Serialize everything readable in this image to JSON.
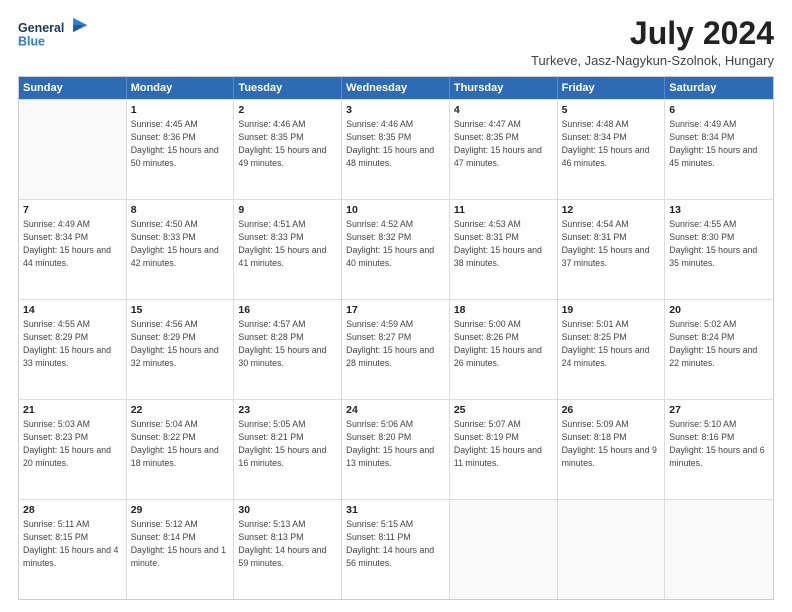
{
  "header": {
    "logo_general": "General",
    "logo_blue": "Blue",
    "month_year": "July 2024",
    "location": "Turkeve, Jasz-Nagykun-Szolnok, Hungary"
  },
  "days_of_week": [
    "Sunday",
    "Monday",
    "Tuesday",
    "Wednesday",
    "Thursday",
    "Friday",
    "Saturday"
  ],
  "weeks": [
    [
      {
        "day": "",
        "sunrise": "",
        "sunset": "",
        "daylight": ""
      },
      {
        "day": "1",
        "sunrise": "Sunrise: 4:45 AM",
        "sunset": "Sunset: 8:36 PM",
        "daylight": "Daylight: 15 hours and 50 minutes."
      },
      {
        "day": "2",
        "sunrise": "Sunrise: 4:46 AM",
        "sunset": "Sunset: 8:35 PM",
        "daylight": "Daylight: 15 hours and 49 minutes."
      },
      {
        "day": "3",
        "sunrise": "Sunrise: 4:46 AM",
        "sunset": "Sunset: 8:35 PM",
        "daylight": "Daylight: 15 hours and 48 minutes."
      },
      {
        "day": "4",
        "sunrise": "Sunrise: 4:47 AM",
        "sunset": "Sunset: 8:35 PM",
        "daylight": "Daylight: 15 hours and 47 minutes."
      },
      {
        "day": "5",
        "sunrise": "Sunrise: 4:48 AM",
        "sunset": "Sunset: 8:34 PM",
        "daylight": "Daylight: 15 hours and 46 minutes."
      },
      {
        "day": "6",
        "sunrise": "Sunrise: 4:49 AM",
        "sunset": "Sunset: 8:34 PM",
        "daylight": "Daylight: 15 hours and 45 minutes."
      }
    ],
    [
      {
        "day": "7",
        "sunrise": "Sunrise: 4:49 AM",
        "sunset": "Sunset: 8:34 PM",
        "daylight": "Daylight: 15 hours and 44 minutes."
      },
      {
        "day": "8",
        "sunrise": "Sunrise: 4:50 AM",
        "sunset": "Sunset: 8:33 PM",
        "daylight": "Daylight: 15 hours and 42 minutes."
      },
      {
        "day": "9",
        "sunrise": "Sunrise: 4:51 AM",
        "sunset": "Sunset: 8:33 PM",
        "daylight": "Daylight: 15 hours and 41 minutes."
      },
      {
        "day": "10",
        "sunrise": "Sunrise: 4:52 AM",
        "sunset": "Sunset: 8:32 PM",
        "daylight": "Daylight: 15 hours and 40 minutes."
      },
      {
        "day": "11",
        "sunrise": "Sunrise: 4:53 AM",
        "sunset": "Sunset: 8:31 PM",
        "daylight": "Daylight: 15 hours and 38 minutes."
      },
      {
        "day": "12",
        "sunrise": "Sunrise: 4:54 AM",
        "sunset": "Sunset: 8:31 PM",
        "daylight": "Daylight: 15 hours and 37 minutes."
      },
      {
        "day": "13",
        "sunrise": "Sunrise: 4:55 AM",
        "sunset": "Sunset: 8:30 PM",
        "daylight": "Daylight: 15 hours and 35 minutes."
      }
    ],
    [
      {
        "day": "14",
        "sunrise": "Sunrise: 4:55 AM",
        "sunset": "Sunset: 8:29 PM",
        "daylight": "Daylight: 15 hours and 33 minutes."
      },
      {
        "day": "15",
        "sunrise": "Sunrise: 4:56 AM",
        "sunset": "Sunset: 8:29 PM",
        "daylight": "Daylight: 15 hours and 32 minutes."
      },
      {
        "day": "16",
        "sunrise": "Sunrise: 4:57 AM",
        "sunset": "Sunset: 8:28 PM",
        "daylight": "Daylight: 15 hours and 30 minutes."
      },
      {
        "day": "17",
        "sunrise": "Sunrise: 4:59 AM",
        "sunset": "Sunset: 8:27 PM",
        "daylight": "Daylight: 15 hours and 28 minutes."
      },
      {
        "day": "18",
        "sunrise": "Sunrise: 5:00 AM",
        "sunset": "Sunset: 8:26 PM",
        "daylight": "Daylight: 15 hours and 26 minutes."
      },
      {
        "day": "19",
        "sunrise": "Sunrise: 5:01 AM",
        "sunset": "Sunset: 8:25 PM",
        "daylight": "Daylight: 15 hours and 24 minutes."
      },
      {
        "day": "20",
        "sunrise": "Sunrise: 5:02 AM",
        "sunset": "Sunset: 8:24 PM",
        "daylight": "Daylight: 15 hours and 22 minutes."
      }
    ],
    [
      {
        "day": "21",
        "sunrise": "Sunrise: 5:03 AM",
        "sunset": "Sunset: 8:23 PM",
        "daylight": "Daylight: 15 hours and 20 minutes."
      },
      {
        "day": "22",
        "sunrise": "Sunrise: 5:04 AM",
        "sunset": "Sunset: 8:22 PM",
        "daylight": "Daylight: 15 hours and 18 minutes."
      },
      {
        "day": "23",
        "sunrise": "Sunrise: 5:05 AM",
        "sunset": "Sunset: 8:21 PM",
        "daylight": "Daylight: 15 hours and 16 minutes."
      },
      {
        "day": "24",
        "sunrise": "Sunrise: 5:06 AM",
        "sunset": "Sunset: 8:20 PM",
        "daylight": "Daylight: 15 hours and 13 minutes."
      },
      {
        "day": "25",
        "sunrise": "Sunrise: 5:07 AM",
        "sunset": "Sunset: 8:19 PM",
        "daylight": "Daylight: 15 hours and 11 minutes."
      },
      {
        "day": "26",
        "sunrise": "Sunrise: 5:09 AM",
        "sunset": "Sunset: 8:18 PM",
        "daylight": "Daylight: 15 hours and 9 minutes."
      },
      {
        "day": "27",
        "sunrise": "Sunrise: 5:10 AM",
        "sunset": "Sunset: 8:16 PM",
        "daylight": "Daylight: 15 hours and 6 minutes."
      }
    ],
    [
      {
        "day": "28",
        "sunrise": "Sunrise: 5:11 AM",
        "sunset": "Sunset: 8:15 PM",
        "daylight": "Daylight: 15 hours and 4 minutes."
      },
      {
        "day": "29",
        "sunrise": "Sunrise: 5:12 AM",
        "sunset": "Sunset: 8:14 PM",
        "daylight": "Daylight: 15 hours and 1 minute."
      },
      {
        "day": "30",
        "sunrise": "Sunrise: 5:13 AM",
        "sunset": "Sunset: 8:13 PM",
        "daylight": "Daylight: 14 hours and 59 minutes."
      },
      {
        "day": "31",
        "sunrise": "Sunrise: 5:15 AM",
        "sunset": "Sunset: 8:11 PM",
        "daylight": "Daylight: 14 hours and 56 minutes."
      },
      {
        "day": "",
        "sunrise": "",
        "sunset": "",
        "daylight": ""
      },
      {
        "day": "",
        "sunrise": "",
        "sunset": "",
        "daylight": ""
      },
      {
        "day": "",
        "sunrise": "",
        "sunset": "",
        "daylight": ""
      }
    ]
  ]
}
